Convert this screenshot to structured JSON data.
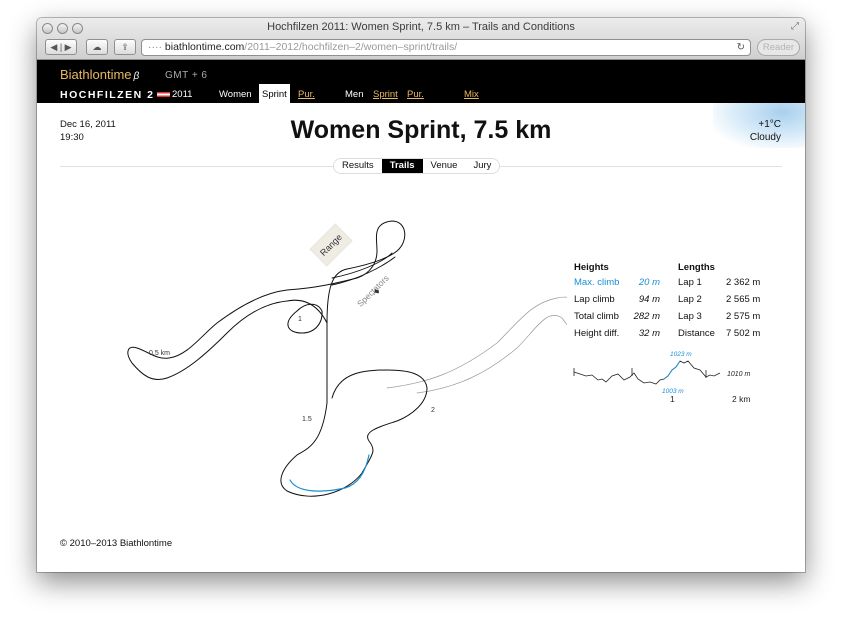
{
  "window": {
    "title": "Hochfilzen 2011: Women Sprint, 7.5 km – Trails and Conditions"
  },
  "address_bar": {
    "host": "biathlontime.com",
    "path": "/2011–2012/hochfilzen–2/women–sprint/trails/",
    "reader_label": "Reader"
  },
  "header": {
    "logo": "Biathlontime",
    "logo_suffix": "β",
    "timezone": "GMT + 6",
    "place": "HOCHFILZEN 2",
    "year": "2011",
    "women_label": "Women",
    "women_sprint": "Sprint",
    "women_pursuit": "Pur.",
    "men_label": "Men",
    "men_sprint": "Sprint",
    "men_pursuit": "Pur.",
    "mix": "Mix"
  },
  "event": {
    "date": "Dec 16, 2011",
    "time": "19:30",
    "title": "Women Sprint, 7.5 km",
    "temperature": "+1°C",
    "condition": "Cloudy"
  },
  "tabs": [
    "Results",
    "Trails",
    "Venue",
    "Jury"
  ],
  "active_tab": "Trails",
  "map": {
    "range_label": "Range",
    "spectators_label": "Spectators",
    "km_labels": [
      "0.5 km",
      "1",
      "1.5",
      "2"
    ]
  },
  "heights": {
    "title": "Heights",
    "rows": [
      {
        "label": "Max. climb",
        "value": "20 m"
      },
      {
        "label": "Lap climb",
        "value": "94 m"
      },
      {
        "label": "Total climb",
        "value": "282 m"
      },
      {
        "label": "Height diff.",
        "value": "32 m"
      }
    ]
  },
  "lengths": {
    "title": "Lengths",
    "rows": [
      {
        "label": "Lap 1",
        "value": "2 362 m"
      },
      {
        "label": "Lap 2",
        "value": "2 565 m"
      },
      {
        "label": "Lap 3",
        "value": "2 575 m"
      },
      {
        "label": "Distance",
        "value": "7 502 m"
      }
    ]
  },
  "profile": {
    "max_label": "1023 m",
    "min_label": "1003 m",
    "end_label": "1010 m",
    "x_labels": [
      "1",
      "2 km"
    ]
  },
  "footer": {
    "copyright": "© 2010–2013 Biathlontime"
  },
  "colors": {
    "accent": "#e8b860",
    "climb_blue": "#1a8fd6",
    "header_bg": "#000000"
  }
}
